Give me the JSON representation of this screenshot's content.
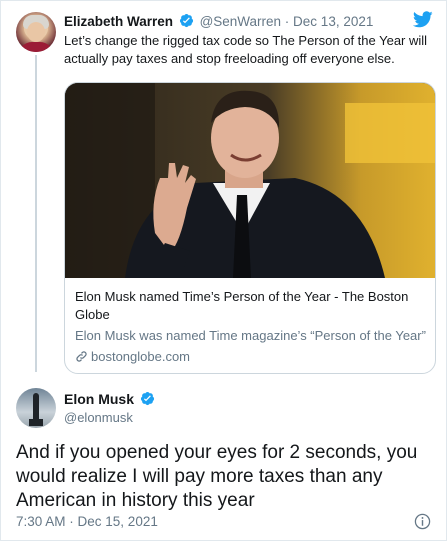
{
  "quoted_tweet": {
    "author_name": "Elizabeth Warren",
    "handle": "@SenWarren",
    "separator": " · ",
    "date": "Dec 13, 2021",
    "text": "Let’s change the rigged tax code so The Person of the Year will actually pay taxes and stop freeloading off everyone else.",
    "card": {
      "title": "Elon Musk named Time’s Person of the Year - The Boston Globe",
      "description": "Elon Musk was named Time magazine’s “Person of the Year”",
      "domain": "bostonglobe.com"
    }
  },
  "main_tweet": {
    "author_name": "Elon Musk",
    "handle": "@elonmusk",
    "text": "And if you opened your eyes for 2 seconds, you would realize I will pay more taxes than any American in history this year",
    "time": "7:30 AM",
    "separator": " · ",
    "date": "Dec 15, 2021"
  },
  "colors": {
    "twitter_blue": "#1da1f2",
    "verified_blue": "#1da1f2",
    "muted_text": "#657786",
    "border": "#ccd6dd"
  },
  "icons": [
    "verified-badge-icon",
    "twitter-bird-icon",
    "link-icon",
    "info-icon"
  ]
}
